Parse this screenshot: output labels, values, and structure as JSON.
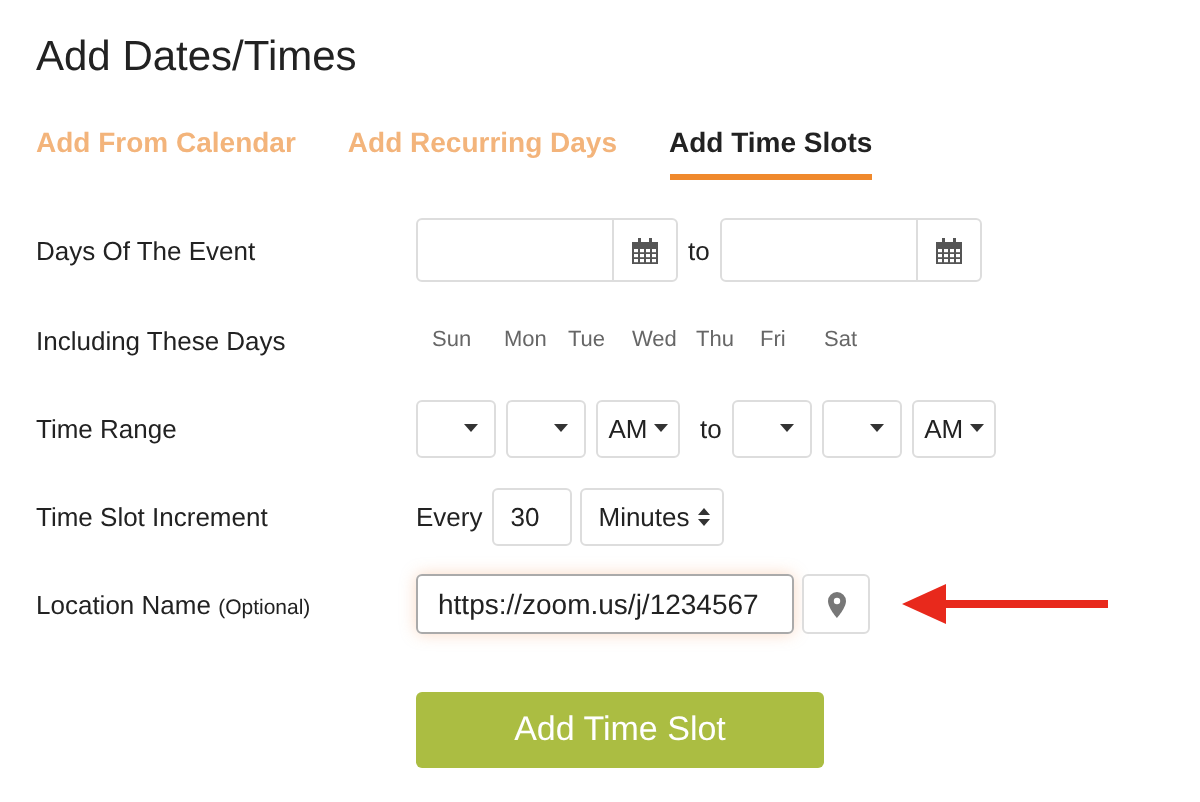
{
  "title": "Add Dates/Times",
  "tabs": [
    {
      "label": "Add From Calendar",
      "selected": false
    },
    {
      "label": "Add Recurring Days",
      "selected": false
    },
    {
      "label": "Add Time Slots",
      "selected": true
    }
  ],
  "rows": [
    {
      "kind": "date-range",
      "label": "Days Of The Event",
      "joiner": "to"
    },
    {
      "kind": "weekdays",
      "label": "Including These Days",
      "days": [
        "Sun",
        "Mon",
        "Tue",
        "Wed",
        "Thu",
        "Fri",
        "Sat"
      ]
    },
    {
      "kind": "time-range",
      "label": "Time Range",
      "start_period": "AM",
      "joiner": "to",
      "end_period": "AM"
    },
    {
      "kind": "increment",
      "label": "Time Slot Increment",
      "prefix": "Every",
      "value": "30",
      "unit": "Minutes"
    },
    {
      "kind": "location",
      "label": "Location Name",
      "hint": "(Optional)",
      "value": "https://zoom.us/j/1234567",
      "focused": true
    }
  ],
  "submit": "Add Time Slot"
}
